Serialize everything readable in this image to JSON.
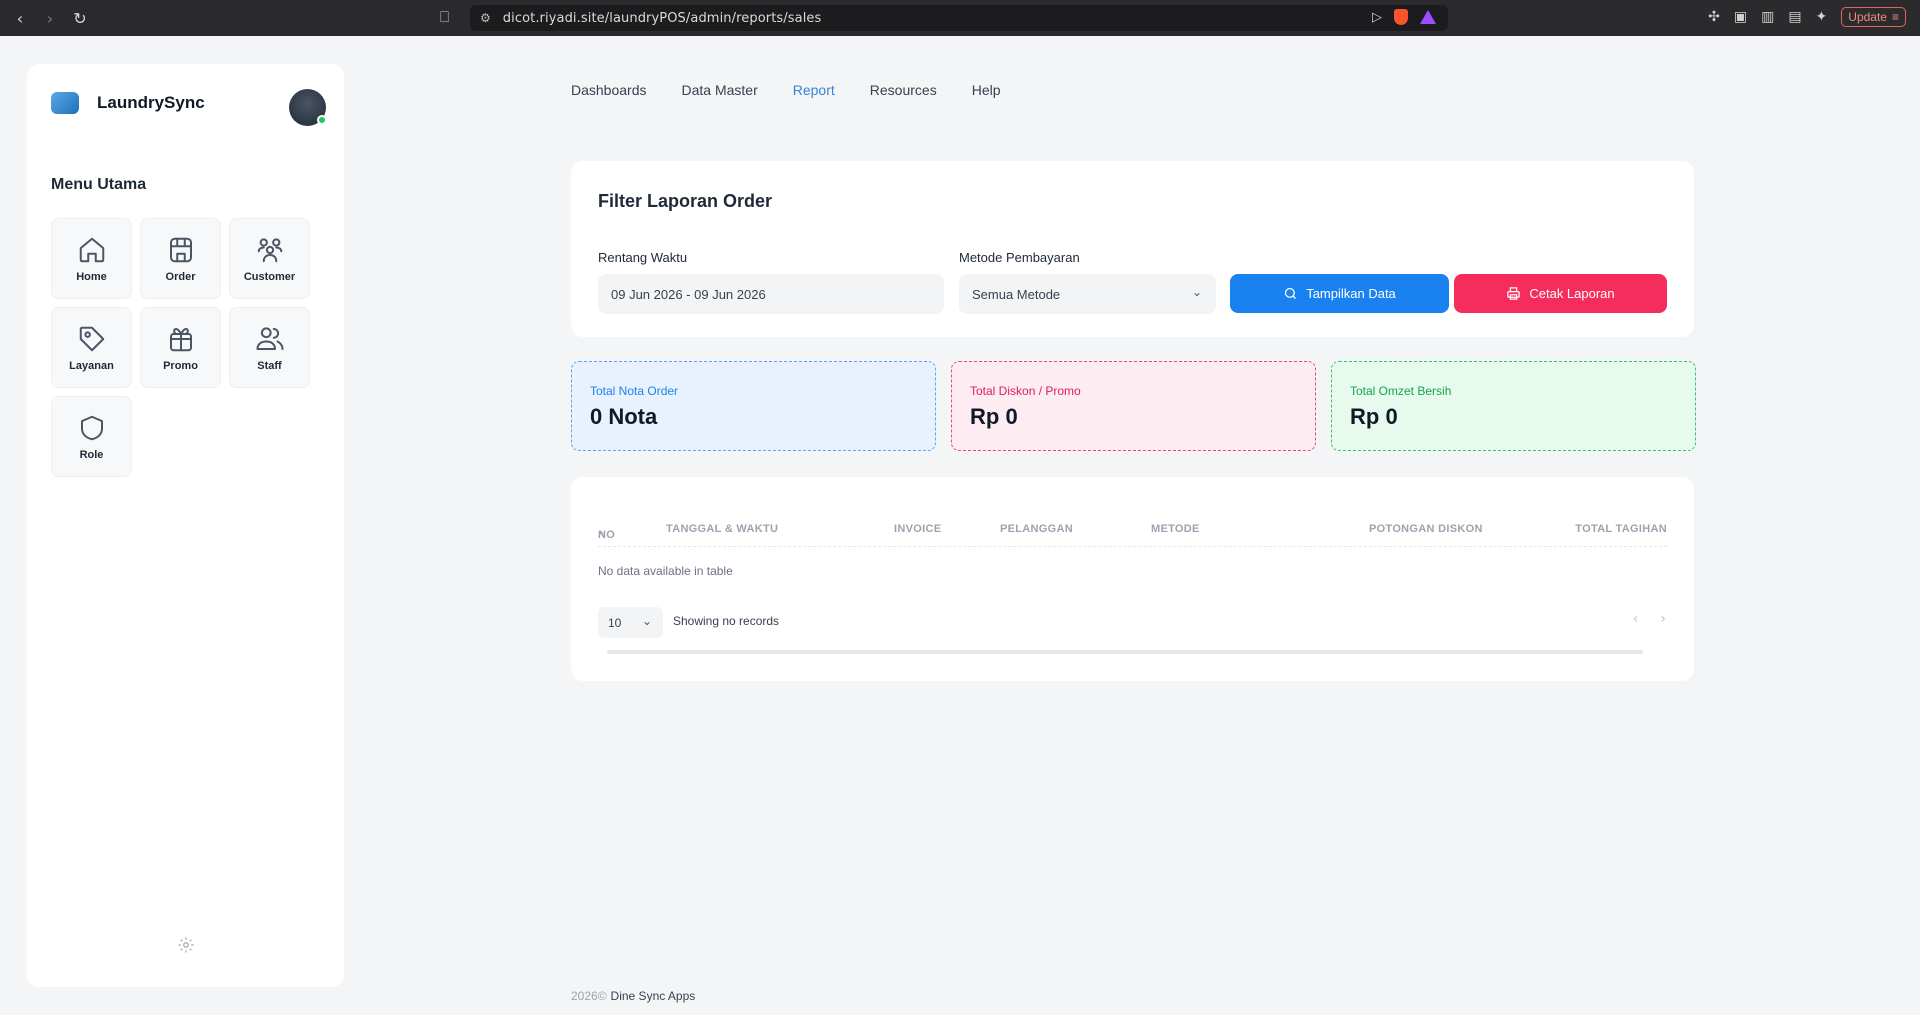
{
  "browser": {
    "url": "dicot.riyadi.site/laundryPOS/admin/reports/sales",
    "update_label": "Update"
  },
  "sidebar": {
    "brand": "LaundrySync",
    "menu_title": "Menu Utama",
    "items": [
      {
        "label": "Home",
        "icon": "home-icon"
      },
      {
        "label": "Order",
        "icon": "store-icon"
      },
      {
        "label": "Customer",
        "icon": "users-icon"
      },
      {
        "label": "Layanan",
        "icon": "tag-icon"
      },
      {
        "label": "Promo",
        "icon": "gift-icon"
      },
      {
        "label": "Staff",
        "icon": "people-icon"
      },
      {
        "label": "Role",
        "icon": "shield-icon"
      }
    ]
  },
  "topnav": {
    "items": [
      "Dashboards",
      "Data Master",
      "Report",
      "Resources",
      "Help"
    ],
    "active": "Report"
  },
  "filter": {
    "title": "Filter Laporan Order",
    "range_label": "Rentang Waktu",
    "range_value": "09 Jun 2026 - 09 Jun 2026",
    "method_label": "Metode Pembayaran",
    "method_value": "Semua Metode",
    "show_button": "Tampilkan Data",
    "print_button": "Cetak Laporan"
  },
  "stats": {
    "orders_label": "Total Nota Order",
    "orders_value": "0 Nota",
    "discount_label": "Total Diskon / Promo",
    "discount_value": "Rp 0",
    "revenue_label": "Total Omzet Bersih",
    "revenue_value": "Rp 0"
  },
  "table": {
    "columns": [
      "NO",
      "TANGGAL & WAKTU",
      "INVOICE",
      "PELANGGAN",
      "METODE",
      "POTONGAN DISKON",
      "TOTAL TAGIHAN"
    ],
    "empty_text": "No data available in table",
    "page_length": "10",
    "info": "Showing no records"
  },
  "footer": {
    "year": "2026©",
    "brand": "Dine Sync Apps"
  },
  "colors": {
    "primary": "#1a82f0",
    "danger": "#f52d5c",
    "success": "#16a34a",
    "active_nav": "#3b82d6"
  }
}
